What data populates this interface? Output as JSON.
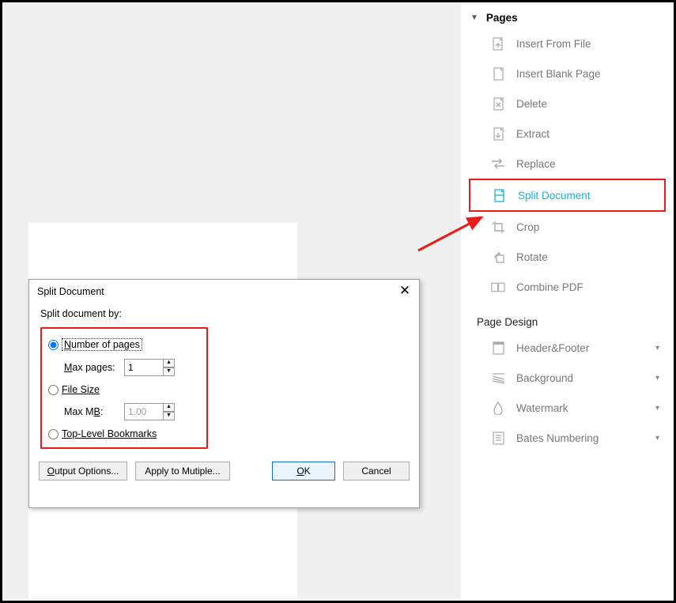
{
  "dialog": {
    "title": "Split Document",
    "close_glyph": "✕",
    "label": "Split document by:",
    "options": {
      "num_pages": {
        "label_pre": "N",
        "label_rest": "umber of pages",
        "max_label_pre": "M",
        "max_label_rest": "ax pages:",
        "max_value": "1"
      },
      "file_size": {
        "label_pre": "F",
        "label_rest": "ile Size",
        "max_label_pre": "Max M",
        "max_label_under": "B",
        "max_label_post": ":",
        "max_value": "1.00"
      },
      "bookmarks": {
        "label_pre": "Top-Level ",
        "label_under": "B",
        "label_rest": "ookmarks"
      }
    },
    "buttons": {
      "output": "Output Options...",
      "apply": "Apply to Mutiple...",
      "ok": "OK",
      "cancel": "Cancel"
    }
  },
  "right": {
    "pages_header": "Pages",
    "items": {
      "insert_from_file": "Insert From File",
      "insert_blank": "Insert Blank Page",
      "delete": "Delete",
      "extract": "Extract",
      "replace": "Replace",
      "split": "Split Document",
      "crop": "Crop",
      "rotate": "Rotate",
      "combine": "Combine PDF"
    },
    "page_design_header": "Page Design",
    "design_items": {
      "header_footer": "Header&Footer",
      "background": "Background",
      "watermark": "Watermark",
      "bates": "Bates Numbering"
    }
  }
}
